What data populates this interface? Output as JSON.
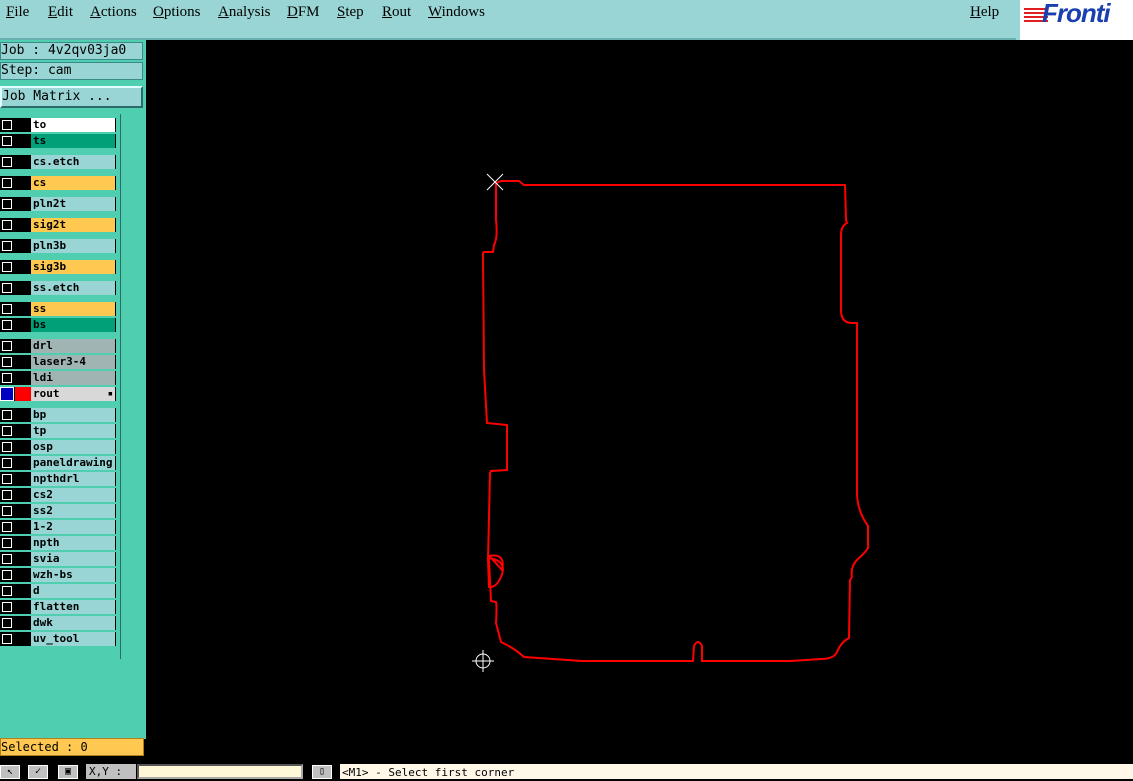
{
  "menu": [
    {
      "id": "file",
      "label": "File"
    },
    {
      "id": "edit",
      "label": "Edit"
    },
    {
      "id": "actions",
      "label": "Actions"
    },
    {
      "id": "options",
      "label": "Options"
    },
    {
      "id": "analysis",
      "label": "Analysis"
    },
    {
      "id": "dfm",
      "label": "DFM"
    },
    {
      "id": "step",
      "label": "Step"
    },
    {
      "id": "rout",
      "label": "Rout"
    },
    {
      "id": "windows",
      "label": "Windows"
    },
    {
      "id": "help",
      "label": "Help"
    }
  ],
  "logo": {
    "text": "Fronti",
    "icon": "frontline-logo-icon"
  },
  "job": {
    "label": "Job : 4v2qv03ja0"
  },
  "step": {
    "label": "Step: cam"
  },
  "job_matrix_button": "Job Matrix ...",
  "layers": [
    {
      "name": "to",
      "bg": "#ffffff"
    },
    {
      "name": "ts",
      "bg": "#00a078"
    },
    {
      "name": "cs.etch",
      "bg": "#99d5d5"
    },
    {
      "name": "cs",
      "bg": "#ffc850"
    },
    {
      "name": "pln2t",
      "bg": "#99d5d5"
    },
    {
      "name": "sig2t",
      "bg": "#ffc850"
    },
    {
      "name": "pln3b",
      "bg": "#99d5d5"
    },
    {
      "name": "sig3b",
      "bg": "#ffc850"
    },
    {
      "name": "ss.etch",
      "bg": "#99d5d5"
    },
    {
      "name": "ss",
      "bg": "#ffc850"
    },
    {
      "name": "bs",
      "bg": "#00a078"
    },
    {
      "name": "drl",
      "bg": "#a0b4b4"
    },
    {
      "name": "laser3-4",
      "bg": "#a0b4b4"
    },
    {
      "name": "ldi",
      "bg": "#a0b4b4"
    },
    {
      "name": "rout",
      "bg": "#d8d8d8"
    },
    {
      "name": "bp",
      "bg": "#99d5d5"
    },
    {
      "name": "tp",
      "bg": "#99d5d5"
    },
    {
      "name": "osp",
      "bg": "#99d5d5"
    },
    {
      "name": "paneldrawing",
      "bg": "#99d5d5"
    },
    {
      "name": "npthdrl",
      "bg": "#99d5d5"
    },
    {
      "name": "cs2",
      "bg": "#99d5d5"
    },
    {
      "name": "ss2",
      "bg": "#99d5d5"
    },
    {
      "name": "1-2",
      "bg": "#99d5d5"
    },
    {
      "name": "npth",
      "bg": "#99d5d5"
    },
    {
      "name": "svia",
      "bg": "#99d5d5"
    },
    {
      "name": "wzh-bs",
      "bg": "#99d5d5"
    },
    {
      "name": "d",
      "bg": "#99d5d5"
    },
    {
      "name": "flatten",
      "bg": "#99d5d5"
    },
    {
      "name": "dwk",
      "bg": "#99d5d5"
    },
    {
      "name": "uv_tool",
      "bg": "#99d5d5"
    }
  ],
  "active_layer": {
    "name": "rout",
    "color": "#ff0000",
    "work_marker": "#0000c0"
  },
  "selected": {
    "label": "Selected : 0"
  },
  "statusbar": {
    "xy_label": "X,Y :",
    "prompt": "<M1> - Select first corner"
  },
  "colors": {
    "outline": "#ff0000",
    "background": "#000000",
    "menubar": "#99d5d5",
    "sidebar": "#4fcfb0"
  }
}
